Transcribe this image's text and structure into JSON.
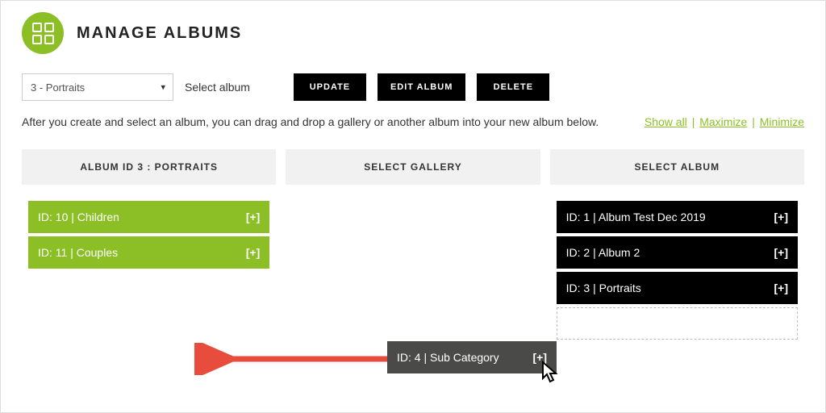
{
  "header": {
    "title": "MANAGE ALBUMS"
  },
  "toolbar": {
    "select_value": "3 - Portraits",
    "select_label": "Select album",
    "update_label": "UPDATE",
    "edit_label": "EDIT ALBUM",
    "delete_label": "DELETE"
  },
  "hint": "After you create and select an album, you can drag and drop a gallery or another album into your new album below.",
  "links": {
    "show_all": "Show all",
    "maximize": "Maximize",
    "minimize": "Minimize"
  },
  "panels": {
    "left": {
      "header": "ALBUM ID 3 : PORTRAITS",
      "items": [
        {
          "label": "ID: 10 | Children",
          "toggle": "[+]"
        },
        {
          "label": "ID: 11 | Couples",
          "toggle": "[+]"
        }
      ]
    },
    "middle": {
      "header": "SELECT GALLERY"
    },
    "right": {
      "header": "SELECT ALBUM",
      "items": [
        {
          "label": "ID: 1 | Album Test Dec 2019",
          "toggle": "[+]"
        },
        {
          "label": "ID: 2 | Album 2",
          "toggle": "[+]"
        },
        {
          "label": "ID: 3 | Portraits",
          "toggle": "[+]"
        }
      ]
    }
  },
  "drag_item": {
    "label": "ID: 4 | Sub Category",
    "toggle": "[+]"
  }
}
